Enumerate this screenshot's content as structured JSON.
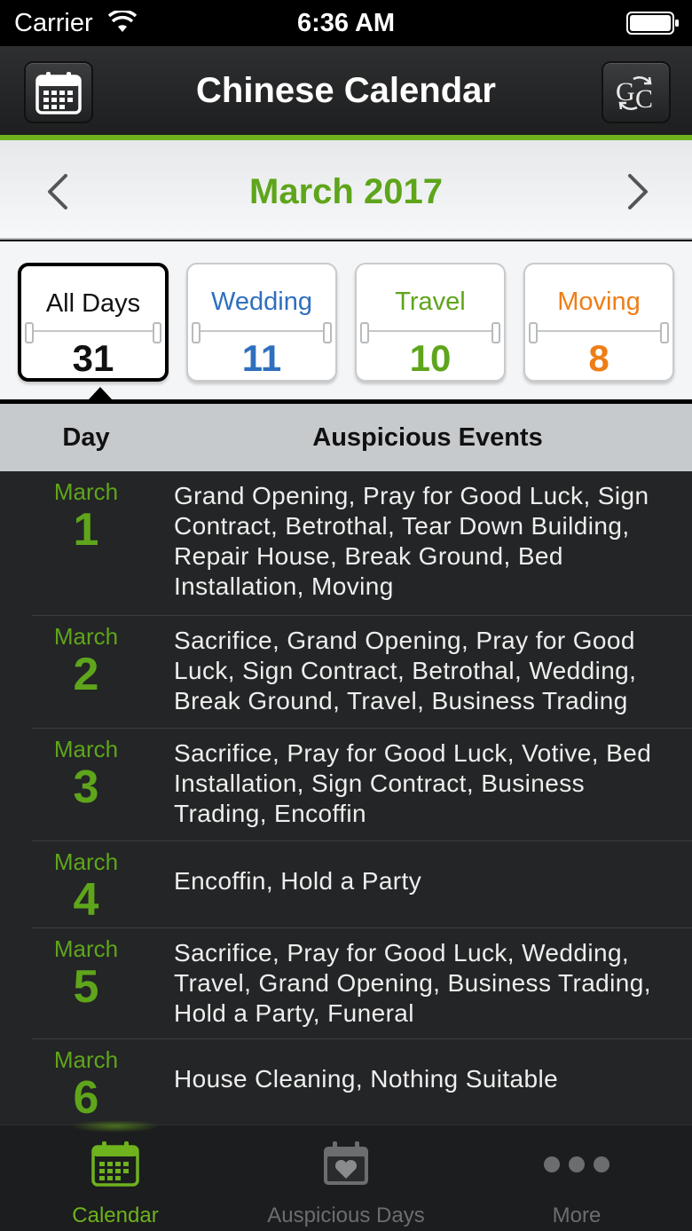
{
  "status_bar": {
    "carrier": "Carrier",
    "time": "6:36 AM"
  },
  "nav": {
    "title": "Chinese Calendar",
    "left_icon": "calendar-icon",
    "right_icon": "gregorian-chinese-convert-icon"
  },
  "month": {
    "title": "March 2017"
  },
  "categories": [
    {
      "label": "All Days",
      "count": "31",
      "color": "#111111",
      "selected": true
    },
    {
      "label": "Wedding",
      "count": "11",
      "color": "#2f6fbf",
      "selected": false
    },
    {
      "label": "Travel",
      "count": "10",
      "color": "#5ea51b",
      "selected": false
    },
    {
      "label": "Moving",
      "count": "8",
      "color": "#ef7d16",
      "selected": false
    }
  ],
  "table": {
    "col_day": "Day",
    "col_events": "Auspicious Events"
  },
  "days": [
    {
      "month": "March",
      "day": "1",
      "events": "Grand Opening, Pray for Good Luck, Sign Contract, Betrothal, Tear Down Building, Repair House, Break Ground, Bed Installation, Moving"
    },
    {
      "month": "March",
      "day": "2",
      "events": "Sacrifice, Grand Opening, Pray for Good Luck, Sign Contract, Betrothal, Wedding, Break Ground, Travel, Business Trading"
    },
    {
      "month": "March",
      "day": "3",
      "events": "Sacrifice, Pray for Good Luck, Votive, Bed Installation, Sign Contract, Business Trading, Encoffin"
    },
    {
      "month": "March",
      "day": "4",
      "events": "Encoffin, Hold a Party"
    },
    {
      "month": "March",
      "day": "5",
      "events": "Sacrifice, Pray for Good Luck, Wedding, Travel, Grand Opening, Business Trading, Hold a Party, Funeral"
    },
    {
      "month": "March",
      "day": "6",
      "events": "House Cleaning, Nothing Suitable"
    }
  ],
  "tabs": [
    {
      "label": "Calendar",
      "icon": "calendar-icon",
      "active": true
    },
    {
      "label": "Auspicious Days",
      "icon": "heart-calendar-icon",
      "active": false
    },
    {
      "label": "More",
      "icon": "more-dots-icon",
      "active": false
    }
  ]
}
